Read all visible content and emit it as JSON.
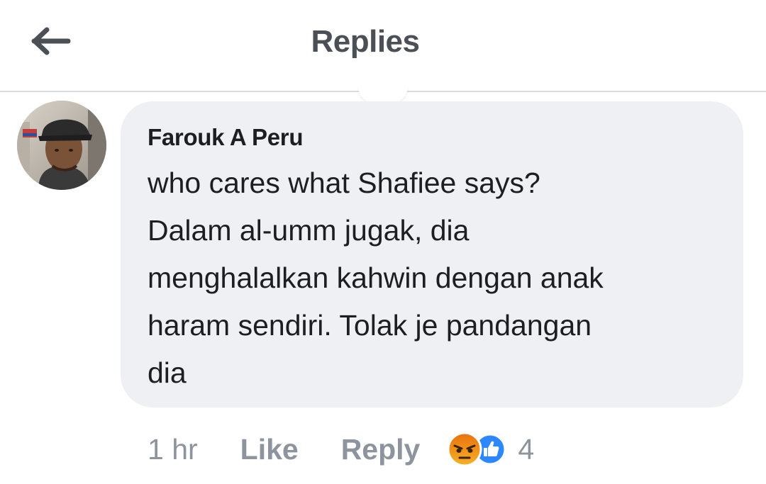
{
  "header": {
    "back_icon": "arrow-left-icon",
    "title": "Replies"
  },
  "comment": {
    "author": "Farouk A Peru",
    "avatar_icon": "profile-photo",
    "text": "who cares what Shafiee says?\nDalam al-umm jugak, dia\nmenghalalkan kahwin dengan anak\nharam sendiri. Tolak je pandangan\ndia",
    "time": "1 hr",
    "like_label": "Like",
    "reply_label": "Reply",
    "reactions": {
      "icons": [
        "angry-reaction-icon",
        "like-reaction-icon"
      ],
      "count": "4"
    }
  },
  "colors": {
    "bubble": "#eef0f3",
    "muted_text": "#8d949e",
    "header_title": "#4b4f56",
    "like_blue": "#2d88ff",
    "angry_top": "#e9710f",
    "angry_bottom": "#f7b125"
  }
}
